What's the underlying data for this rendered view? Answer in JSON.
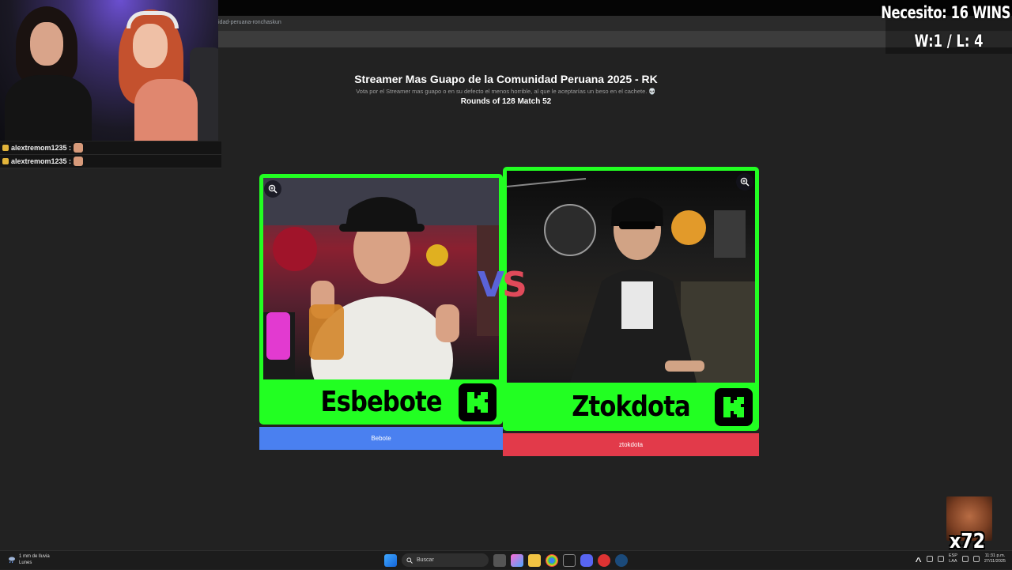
{
  "browser": {
    "url_fragment": "idad-peruana-ronchaskun"
  },
  "overlay": {
    "needs": "Necesito: 16 WINS",
    "record": "W:1 / L: 4",
    "combo": "x72"
  },
  "chat": {
    "messages": [
      {
        "user": "alextremom1235 :"
      },
      {
        "user": "alextremom1235 :"
      }
    ]
  },
  "page": {
    "title": "Streamer Mas Guapo de la Comunidad Peruana 2025 - RK",
    "subtitle": "Vota por el Streamer mas guapo o en su defecto el menos horrible, al que le aceptarías un beso en el cachete. 💀",
    "round": "Rounds of 128 Match 52",
    "vs": {
      "v": "V",
      "s": "S"
    }
  },
  "contestants": {
    "left": {
      "name": "Esbebote",
      "vote_label": "Bebote",
      "color": "#4a80f0"
    },
    "right": {
      "name": "Ztokdota",
      "vote_label": "ztokdota",
      "color": "#e23a4a"
    }
  },
  "card_color": "#22ff22",
  "taskbar": {
    "weather_line1": "1 mm de lluvia",
    "weather_line2": "Lunes",
    "search_placeholder": "Buscar",
    "lang_line1": "ESP",
    "lang_line2": "LAA",
    "time": "11:31 p.m.",
    "date": "27/11/2025"
  }
}
